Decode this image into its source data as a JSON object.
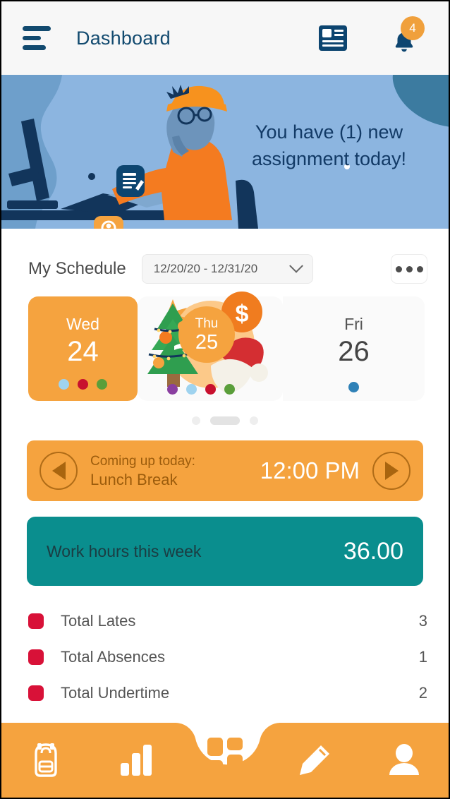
{
  "header": {
    "menu_icon": "hamburger-menu-icon",
    "title": "Dashboard",
    "news_icon": "news-article-icon",
    "bell_icon": "notification-bell-icon",
    "notification_count": "4",
    "badge_color": "#f0a03c",
    "title_color": "#124a6f"
  },
  "banner": {
    "message": "You have (1) new assignment today!",
    "background_color": "#8cb5e0",
    "text_color": "#123a66",
    "doc_chip_icon": "document-edit-icon",
    "profile_chip_icon": "profile-card-icon",
    "illustration": "person-working-at-desk"
  },
  "schedule": {
    "title": "My Schedule",
    "date_range": "12/20/20 - 12/31/20",
    "dropdown_icon": "chevron-down-icon",
    "more_icon": "more-options-icon",
    "days": [
      {
        "name": "Wed",
        "number": "24",
        "selected": true,
        "dots": [
          "#9fd3ef",
          "#c8102e",
          "#5a9e3a"
        ]
      },
      {
        "name": "Thu",
        "number": "25",
        "selected": false,
        "holiday": "christmas",
        "holiday_icons": [
          "christmas-tree-icon",
          "santa-hat-icon",
          "dollar-coin-icon"
        ],
        "dots": [
          "#8a3fa0",
          "#9fd3ef",
          "#c8102e",
          "#5a9e3a"
        ]
      },
      {
        "name": "Fri",
        "number": "26",
        "selected": false,
        "dots": [
          "#2f81b7"
        ]
      }
    ],
    "pagination": {
      "total": 3,
      "active_index": 1
    }
  },
  "coming_up": {
    "prev_icon": "previous-arrow-icon",
    "next_icon": "next-arrow-icon",
    "label": "Coming up today:",
    "event": "Lunch Break",
    "time": "12:00 PM",
    "background_color": "#f5a33f"
  },
  "work_hours": {
    "label": "Work hours this week",
    "value": "36.00",
    "background_color": "#0a8e8e"
  },
  "stats": {
    "marker_color": "#d81138",
    "rows": [
      {
        "label": "Total Lates",
        "value": "3"
      },
      {
        "label": "Total Absences",
        "value": "1"
      },
      {
        "label": "Total Undertime",
        "value": "2"
      }
    ]
  },
  "bottom_nav": {
    "background_color": "#f5a33f",
    "items": [
      {
        "name": "backpack-icon",
        "label": "Backpack",
        "active": false
      },
      {
        "name": "bar-chart-icon",
        "label": "Reports",
        "active": false
      },
      {
        "name": "dashboard-grid-icon",
        "label": "Dashboard",
        "active": true
      },
      {
        "name": "pencil-icon",
        "label": "Edit",
        "active": false
      },
      {
        "name": "person-icon",
        "label": "Profile",
        "active": false
      }
    ]
  }
}
